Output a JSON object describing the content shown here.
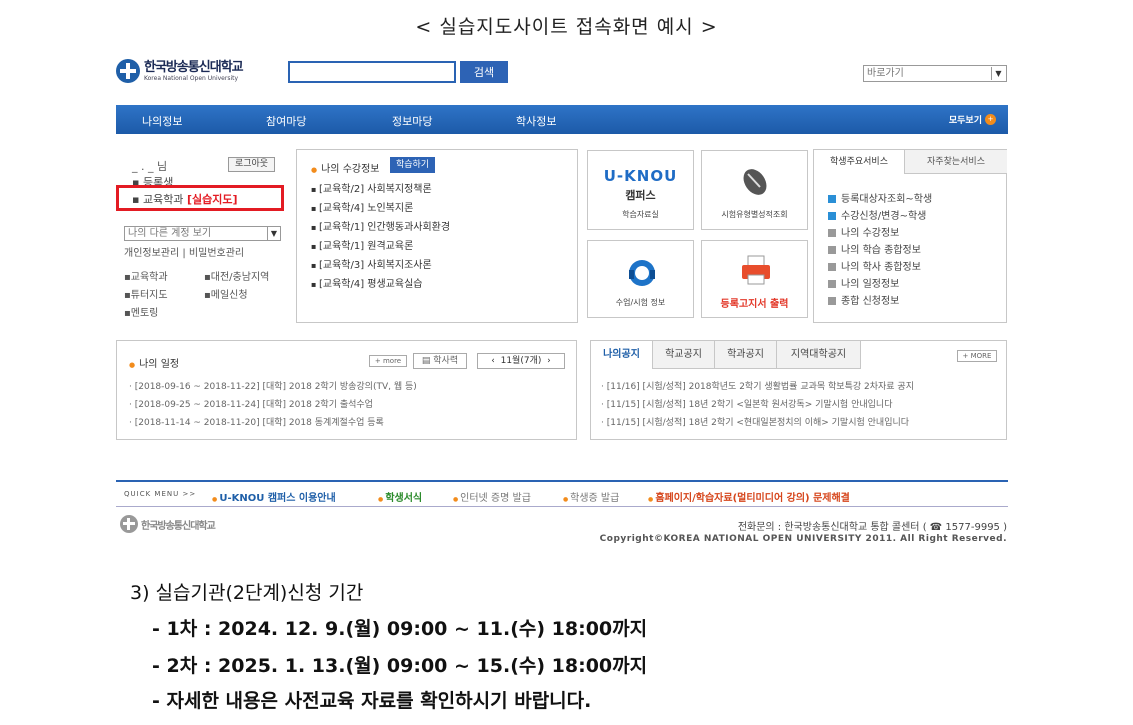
{
  "caption": "< 실습지도사이트 접속화면 예시 >",
  "header": {
    "logo_kr": "한국방송통신대학교",
    "logo_en": "Korea National Open University",
    "search_value": "",
    "search_button": "검색",
    "quick_select": "바로가기"
  },
  "nav": {
    "items": [
      "나의정보",
      "참여마당",
      "정보마당",
      "학사정보"
    ],
    "view_all": "모두보기"
  },
  "user_panel": {
    "user": "_ . _ 님",
    "logout": "로그아웃",
    "line1": "▪ 등록생",
    "line2_prefix": "▪ 교육학과 ",
    "line2_highlight": "[실습지도]",
    "account_select": "나의 다른 계정 보기",
    "account_links": "개인정보관리  |  비밀번호관리",
    "links": [
      "▪교육학과",
      "▪대전/충남지역",
      "▪튜터지도",
      "▪메일신청",
      "▪멘토링"
    ]
  },
  "courses": {
    "title": "나의 수강정보",
    "badge": "학습하기",
    "items": [
      "[교육학/2] 사회복지정책론",
      "[교육학/4] 노인복지론",
      "[교육학/1] 인간행동과사회환경",
      "[교육학/1] 원격교육론",
      "[교육학/3] 사회복지조사론",
      "[교육학/4] 평생교육실습"
    ]
  },
  "tiles": {
    "knou": "U-KNOU",
    "campus": "캠퍼스",
    "tile1_label": "학습자료실",
    "tile2_label": "시험유형별성적조회",
    "tile3_label": "수업/시험 정보",
    "tile4_label": "등록고지서 출력"
  },
  "services": {
    "tab_on": "학생주요서비스",
    "tab_off": "자주찾는서비스",
    "items": [
      "등록대상자조회~학생",
      "수강신청/변경~학생",
      "나의 수강정보",
      "나의 학습 종합정보",
      "나의 학사 종합정보",
      "나의 일정정보",
      "종합 신청정보"
    ]
  },
  "schedule": {
    "title": "나의 일정",
    "more": "+ more",
    "calendar": "학사력",
    "month": "11월(7개)",
    "items": [
      "[2018-09-16 ~ 2018-11-22] [대학] 2018 2학기 방송강의(TV, 웹 등)",
      "[2018-09-25 ~ 2018-11-24] [대학] 2018 2학기 출석수업",
      "[2018-11-14 ~ 2018-11-20] [대학] 2018 동계계절수업 등록"
    ]
  },
  "notice": {
    "tabs": [
      "나의공지",
      "학교공지",
      "학과공지",
      "지역대학공지"
    ],
    "more": "+ MORE",
    "items": [
      "[11/16] [시험/성적] 2018학년도 2학기 생활법률 교과목 학보특강 2차자료 공지",
      "[11/15] [시험/성적] 18년 2학기 <일본학 원서강독> 기말시험 안내입니다",
      "[11/15] [시험/성적] 18년 2학기 <현대일본정치의 이해> 기말시험 안내입니다"
    ]
  },
  "quickbar": {
    "label": "QUICK MENU  >>",
    "items": [
      "U-KNOU 캠퍼스 이용안내",
      "학생서식",
      "인터넷 증명 발급",
      "학생증 발급",
      "홈페이지/학습자료(멀티미디어 강의) 문제해결"
    ]
  },
  "footer": {
    "logo": "한국방송통신대학교",
    "contact": "전화문의 : 한국방송통신대학교 통합 콜센터 ( ☎ 1577-9995 )",
    "copyright": "Copyright©KOREA NATIONAL OPEN UNIVERSITY 2011. All Right Reserved."
  },
  "body_text": {
    "heading": "3) 실습기관(2단계)신청 기간",
    "line1": "- 1차 : 2024. 12. 9.(월) 09:00 ~ 11.(수) 18:00까지",
    "line2": "- 2차 : 2025. 1. 13.(월) 09:00 ~ 15.(수) 18:00까지",
    "line3": "- 자세한 내용은 사전교육 자료를 확인하시기 바랍니다."
  }
}
